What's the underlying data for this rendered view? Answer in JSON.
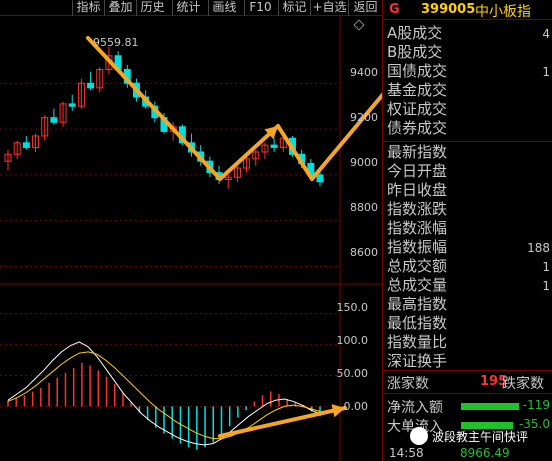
{
  "toolbar": {
    "buttons": [
      "指标",
      "叠加",
      "历史",
      "统计",
      "画线",
      "F10",
      "标记",
      "+自选",
      "返回"
    ]
  },
  "chart": {
    "high_label": "9559.81",
    "price_ticks": [
      "9400",
      "9200",
      "9000",
      "8800",
      "8600"
    ],
    "macd_ticks": [
      "150.0",
      "100.0",
      "50.00",
      "0.00"
    ],
    "colors": {
      "up": "#ff3030",
      "down": "#00e0e0",
      "arrow": "#f5a623",
      "grid": "#7a0000",
      "dif": "#ffffff",
      "dea": "#ffd100"
    }
  },
  "chart_data": {
    "type": "candlestick",
    "price_range": [
      8550,
      9650
    ],
    "candles": [
      {
        "o": 9060,
        "h": 9110,
        "l": 9020,
        "c": 9090
      },
      {
        "o": 9090,
        "h": 9150,
        "l": 9070,
        "c": 9140
      },
      {
        "o": 9140,
        "h": 9170,
        "l": 9110,
        "c": 9120
      },
      {
        "o": 9120,
        "h": 9180,
        "l": 9100,
        "c": 9170
      },
      {
        "o": 9170,
        "h": 9260,
        "l": 9150,
        "c": 9250
      },
      {
        "o": 9250,
        "h": 9290,
        "l": 9220,
        "c": 9230
      },
      {
        "o": 9230,
        "h": 9320,
        "l": 9210,
        "c": 9310
      },
      {
        "o": 9310,
        "h": 9350,
        "l": 9280,
        "c": 9300
      },
      {
        "o": 9300,
        "h": 9420,
        "l": 9290,
        "c": 9400
      },
      {
        "o": 9400,
        "h": 9450,
        "l": 9370,
        "c": 9380
      },
      {
        "o": 9380,
        "h": 9470,
        "l": 9360,
        "c": 9460
      },
      {
        "o": 9460,
        "h": 9559,
        "l": 9440,
        "c": 9520
      },
      {
        "o": 9520,
        "h": 9540,
        "l": 9450,
        "c": 9460
      },
      {
        "o": 9460,
        "h": 9480,
        "l": 9380,
        "c": 9400
      },
      {
        "o": 9400,
        "h": 9420,
        "l": 9320,
        "c": 9340
      },
      {
        "o": 9340,
        "h": 9370,
        "l": 9290,
        "c": 9300
      },
      {
        "o": 9300,
        "h": 9320,
        "l": 9230,
        "c": 9250
      },
      {
        "o": 9250,
        "h": 9270,
        "l": 9180,
        "c": 9190
      },
      {
        "o": 9190,
        "h": 9230,
        "l": 9150,
        "c": 9210
      },
      {
        "o": 9210,
        "h": 9220,
        "l": 9130,
        "c": 9140
      },
      {
        "o": 9140,
        "h": 9180,
        "l": 9080,
        "c": 9100
      },
      {
        "o": 9100,
        "h": 9130,
        "l": 9040,
        "c": 9060
      },
      {
        "o": 9060,
        "h": 9080,
        "l": 8990,
        "c": 9010
      },
      {
        "o": 9010,
        "h": 9040,
        "l": 8960,
        "c": 8980
      },
      {
        "o": 8980,
        "h": 9010,
        "l": 8940,
        "c": 8990
      },
      {
        "o": 8990,
        "h": 9040,
        "l": 8970,
        "c": 9030
      },
      {
        "o": 9030,
        "h": 9080,
        "l": 9010,
        "c": 9070
      },
      {
        "o": 9070,
        "h": 9110,
        "l": 9040,
        "c": 9100
      },
      {
        "o": 9100,
        "h": 9140,
        "l": 9070,
        "c": 9130
      },
      {
        "o": 9130,
        "h": 9160,
        "l": 9100,
        "c": 9120
      },
      {
        "o": 9120,
        "h": 9175,
        "l": 9100,
        "c": 9160
      },
      {
        "o": 9160,
        "h": 9170,
        "l": 9080,
        "c": 9090
      },
      {
        "o": 9090,
        "h": 9110,
        "l": 9030,
        "c": 9050
      },
      {
        "o": 9050,
        "h": 9070,
        "l": 8990,
        "c": 9000
      },
      {
        "o": 9000,
        "h": 9030,
        "l": 8950,
        "c": 8970
      }
    ],
    "macd_range": [
      -80,
      170
    ],
    "macd_bars": [
      10,
      14,
      18,
      24,
      30,
      38,
      46,
      54,
      62,
      70,
      66,
      58,
      48,
      36,
      22,
      6,
      -10,
      -22,
      -34,
      -44,
      -52,
      -60,
      -66,
      -70,
      -66,
      -58,
      -46,
      -32,
      -18,
      -6,
      8,
      18,
      24,
      20,
      12,
      6,
      2,
      -8,
      -16
    ],
    "dif": [
      10,
      20,
      30,
      44,
      58,
      74,
      88,
      98,
      104,
      96,
      80,
      60,
      40,
      20,
      4,
      -12,
      -24,
      -34,
      -42,
      -50,
      -56,
      -60,
      -62,
      -60,
      -52,
      -40,
      -28,
      -16,
      -6,
      4,
      10,
      12,
      8,
      2,
      -6,
      -12
    ],
    "dea": [
      8,
      14,
      22,
      32,
      44,
      56,
      68,
      78,
      86,
      88,
      84,
      74,
      62,
      48,
      34,
      20,
      6,
      -6,
      -16,
      -26,
      -34,
      -42,
      -48,
      -52,
      -52,
      -48,
      -42,
      -34,
      -24,
      -14,
      -6,
      0,
      2,
      0,
      -4,
      -8
    ]
  },
  "panel": {
    "header": {
      "g": "G",
      "code": "399005",
      "name": "中小板指"
    },
    "rows_top": [
      {
        "label": "A股成交",
        "value": "4"
      },
      {
        "label": "B股成交",
        "value": ""
      },
      {
        "label": "国债成交",
        "value": "1"
      },
      {
        "label": "基金成交",
        "value": ""
      },
      {
        "label": "权证成交",
        "value": ""
      },
      {
        "label": "债券成交",
        "value": ""
      }
    ],
    "rows_mid": [
      {
        "label": "最新指数",
        "value": ""
      },
      {
        "label": "今日开盘",
        "value": ""
      },
      {
        "label": "昨日收盘",
        "value": ""
      },
      {
        "label": "指数涨跌",
        "value": ""
      },
      {
        "label": "指数涨幅",
        "value": ""
      },
      {
        "label": "指数振幅",
        "value": "188"
      },
      {
        "label": "总成交额",
        "value": "1"
      },
      {
        "label": "总成交量",
        "value": "1"
      },
      {
        "label": "最高指数",
        "value": ""
      },
      {
        "label": "最低指数",
        "value": ""
      },
      {
        "label": "指数量比",
        "value": ""
      },
      {
        "label": "深证换手",
        "value": ""
      }
    ],
    "up_label": "涨家数",
    "up_value": "195",
    "down_label": "跌家数",
    "flow_in_label": "净流入额",
    "flow_in_value": "-119",
    "flow_big_label": "大单流入",
    "flow_big_value": "-35.0",
    "bottom_time": "14:58",
    "bottom_value": "8966.49",
    "watermark": "波段教主午间快评"
  }
}
